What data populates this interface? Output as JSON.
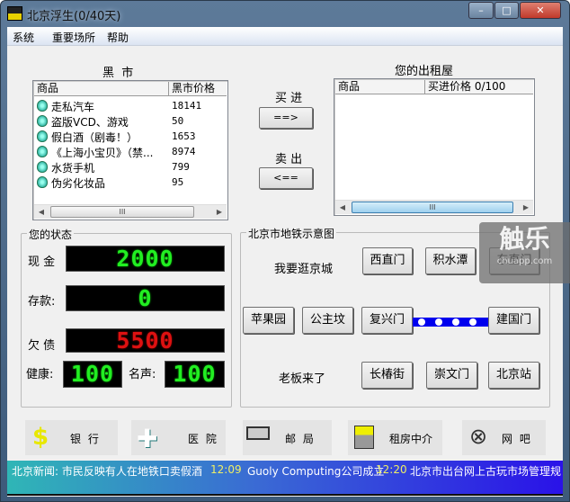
{
  "window": {
    "title": "北京浮生(0/40天)"
  },
  "menu": [
    "系统",
    "重要场所",
    "帮助"
  ],
  "black_market": {
    "title": "黑  市",
    "columns": [
      "商品",
      "黑市价格"
    ],
    "items": [
      {
        "name": "走私汽车",
        "price": "18141"
      },
      {
        "name": "盗版VCD、游戏",
        "price": "50"
      },
      {
        "name": "假白酒（剧毒！）",
        "price": "1653"
      },
      {
        "name": "《上海小宝贝》（禁...",
        "price": "8974"
      },
      {
        "name": "水货手机",
        "price": "799"
      },
      {
        "name": "伪劣化妆品",
        "price": "95"
      }
    ]
  },
  "trade": {
    "buy_label": "买 进",
    "buy_button": "==>",
    "sell_label": "卖 出",
    "sell_button": "<=="
  },
  "rental": {
    "title": "您的出租屋",
    "columns": [
      "商品",
      "买进价格 0/100"
    ]
  },
  "status": {
    "title": "您的状态",
    "cash_label": "现 金",
    "cash": "2000",
    "deposit_label": "存款:",
    "deposit": "0",
    "debt_label": "欠 债",
    "debt": "5500",
    "health_label": "健康:",
    "health": "100",
    "fame_label": "名声:",
    "fame": "100"
  },
  "subway": {
    "title": "北京市地铁示意图",
    "wander": "我要逛京城",
    "boss": "老板来了",
    "stations": [
      "西直门",
      "积水潭",
      "东直门",
      "苹果园",
      "公主坟",
      "复兴门",
      "建国门",
      "长椿街",
      "崇文门",
      "北京站"
    ]
  },
  "places": [
    "银 行",
    "医 院",
    "邮 局",
    "租房中介",
    "网 吧"
  ],
  "ticker": {
    "items": [
      "北京新闻: 市民反映有人在地铁口卖假酒",
      "12:09",
      "Guoly Computing公司成立",
      "12:20",
      "北京市出台网上古玩市场管理规"
    ]
  },
  "watermark": {
    "text": "触乐",
    "sub": "chuapp.com"
  }
}
